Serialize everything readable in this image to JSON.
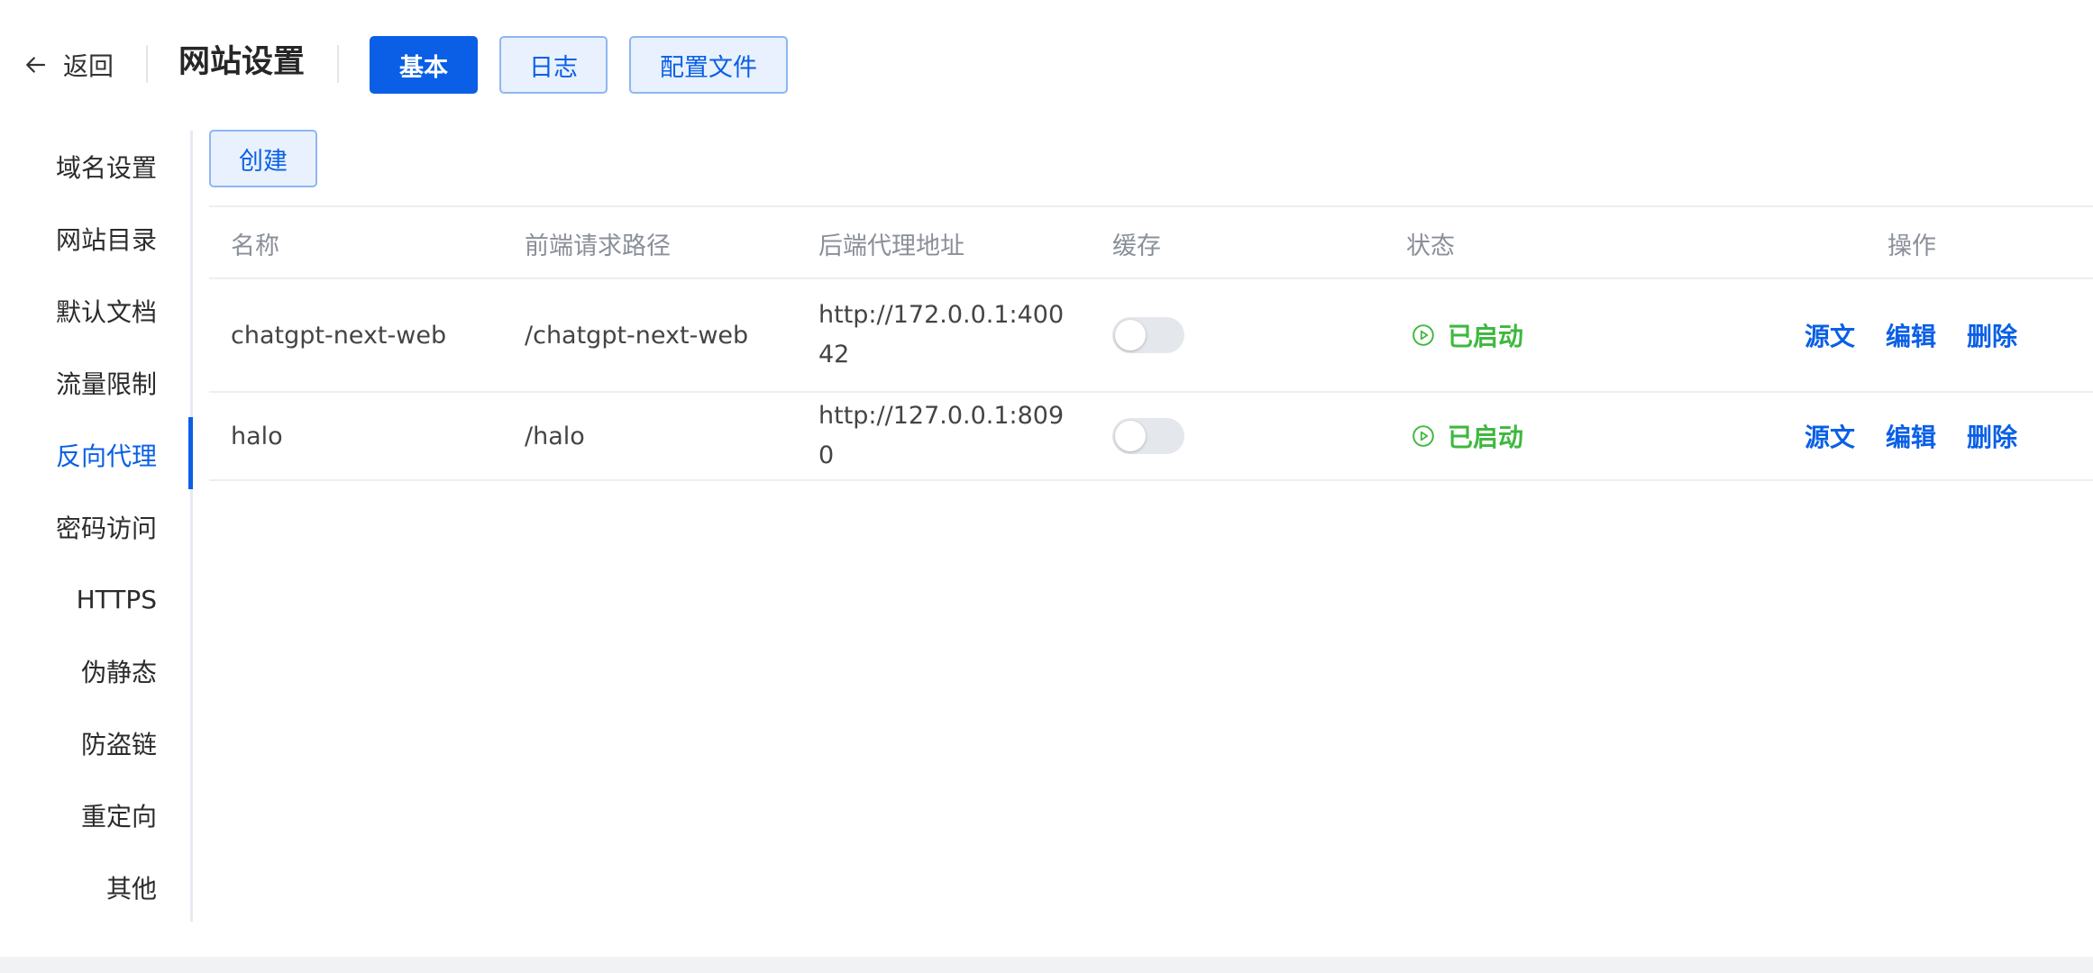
{
  "header": {
    "back_label": "返回",
    "title": "网站设置",
    "tabs": [
      {
        "label": "基本",
        "active": true
      },
      {
        "label": "日志",
        "active": false
      },
      {
        "label": "配置文件",
        "active": false
      }
    ]
  },
  "sidebar": {
    "items": [
      {
        "label": "域名设置"
      },
      {
        "label": "网站目录"
      },
      {
        "label": "默认文档"
      },
      {
        "label": "流量限制"
      },
      {
        "label": "反向代理",
        "active": true
      },
      {
        "label": "密码访问"
      },
      {
        "label": "HTTPS"
      },
      {
        "label": "伪静态"
      },
      {
        "label": "防盗链"
      },
      {
        "label": "重定向"
      },
      {
        "label": "其他"
      }
    ]
  },
  "main": {
    "create_label": "创建",
    "table": {
      "headers": [
        "名称",
        "前端请求路径",
        "后端代理地址",
        "缓存",
        "状态",
        "操作"
      ],
      "rows": [
        {
          "name": "chatgpt-next-web",
          "path": "/chatgpt-next-web",
          "proxy": "http://172.0.0.1:40042",
          "cache": false,
          "status": "已启动",
          "actions": [
            "源文",
            "编辑",
            "删除"
          ]
        },
        {
          "name": "halo",
          "path": "/halo",
          "proxy": "http://127.0.0.1:8090",
          "cache": false,
          "status": "已启动",
          "actions": [
            "源文",
            "编辑",
            "删除"
          ]
        }
      ]
    }
  },
  "colors": {
    "accent": "#0a5fe6",
    "status_running": "#3fb83f",
    "muted_header": "#8a8f99"
  },
  "icons": {
    "back": "arrow-left-icon",
    "status": "play-circle-icon"
  }
}
